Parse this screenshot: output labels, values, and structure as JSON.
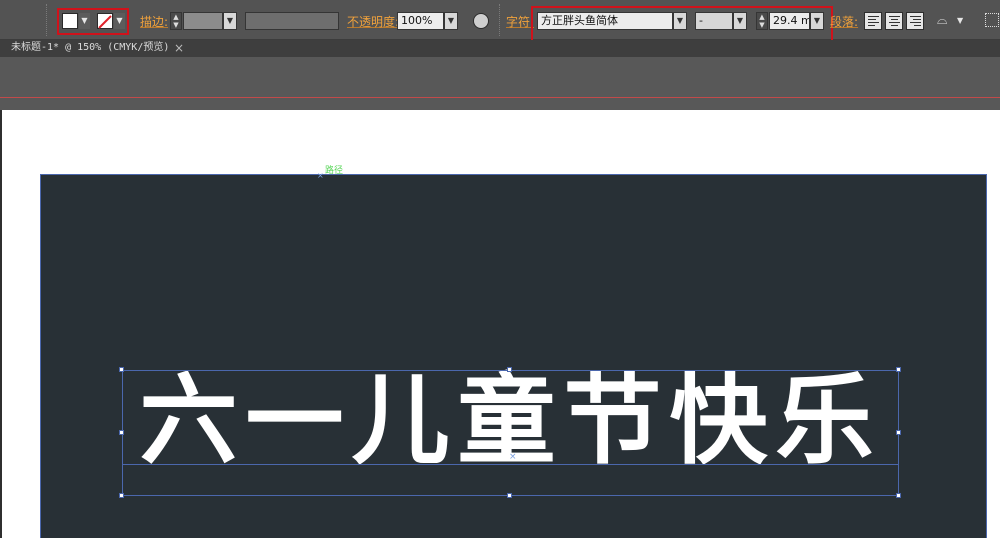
{
  "control_bar": {
    "fill": {
      "color": "#ffffff"
    },
    "stroke": {
      "icon": "none-swatch-icon"
    },
    "stroke_label": "描边:",
    "opacity": {
      "label": "不透明度:",
      "value": "100%"
    },
    "character": {
      "label": "字符:",
      "font_family": "方正胖头鱼简体",
      "font_style": "-",
      "font_size": "29.4 m"
    },
    "paragraph": {
      "label": "段落:"
    }
  },
  "document_tab": {
    "title": "未标题-1* @ 150% (CMYK/预览)",
    "close": "×"
  },
  "canvas": {
    "path_label": "路径",
    "anchor_mark": "×",
    "center_mark": "×",
    "artboard_color": "#283036",
    "text_object": {
      "content": "六一儿童节快乐",
      "color": "#ffffff"
    }
  },
  "colors": {
    "accent_label": "#f0a23c",
    "highlight_box": "#d0121b",
    "selection": "#4b67ad"
  }
}
